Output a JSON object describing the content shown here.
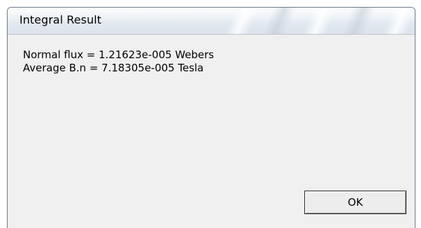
{
  "window": {
    "title": "Integral Result"
  },
  "message": {
    "line1": "Normal flux = 1.21623e-005 Webers",
    "line2": "Average B.n = 7.18305e-005 Tesla"
  },
  "buttons": {
    "ok_label": "OK"
  },
  "colors": {
    "dialog_background": "#f0f0f0",
    "window_border": "#6d7b8c",
    "titlebar_top": "#fcfdfe",
    "titlebar_bottom": "#dde3eb"
  }
}
